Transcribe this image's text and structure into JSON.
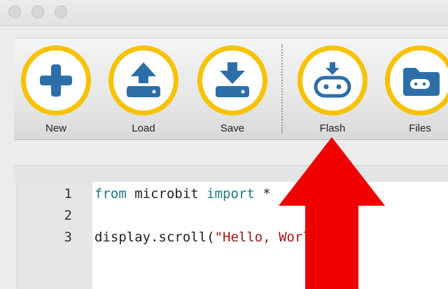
{
  "window": {
    "controls": [
      "close",
      "minimize",
      "zoom"
    ]
  },
  "toolbar": {
    "buttons": [
      {
        "label": "New",
        "icon": "plus-icon"
      },
      {
        "label": "Load",
        "icon": "upload-icon"
      },
      {
        "label": "Save",
        "icon": "download-icon"
      },
      {
        "label": "Flash",
        "icon": "microbit-flash-icon"
      },
      {
        "label": "Files",
        "icon": "folder-microbit-icon"
      }
    ]
  },
  "editor": {
    "lines": [
      {
        "num": "1",
        "parts": [
          {
            "t": "from",
            "k": "kw"
          },
          {
            "t": " microbit ",
            "k": ""
          },
          {
            "t": "import",
            "k": "kw"
          },
          {
            "t": " *",
            "k": ""
          }
        ]
      },
      {
        "num": "2",
        "parts": []
      },
      {
        "num": "3",
        "parts": [
          {
            "t": "display.scroll(",
            "k": ""
          },
          {
            "t": "\"Hello, World!\"",
            "k": "str"
          },
          {
            "t": ")",
            "k": ""
          }
        ]
      }
    ]
  },
  "colors": {
    "accent_ring": "#f7c200",
    "icon_blue": "#2c6fa8",
    "arrow_red": "#f00000",
    "keyword": "#1e7a7a",
    "string": "#a31515"
  }
}
